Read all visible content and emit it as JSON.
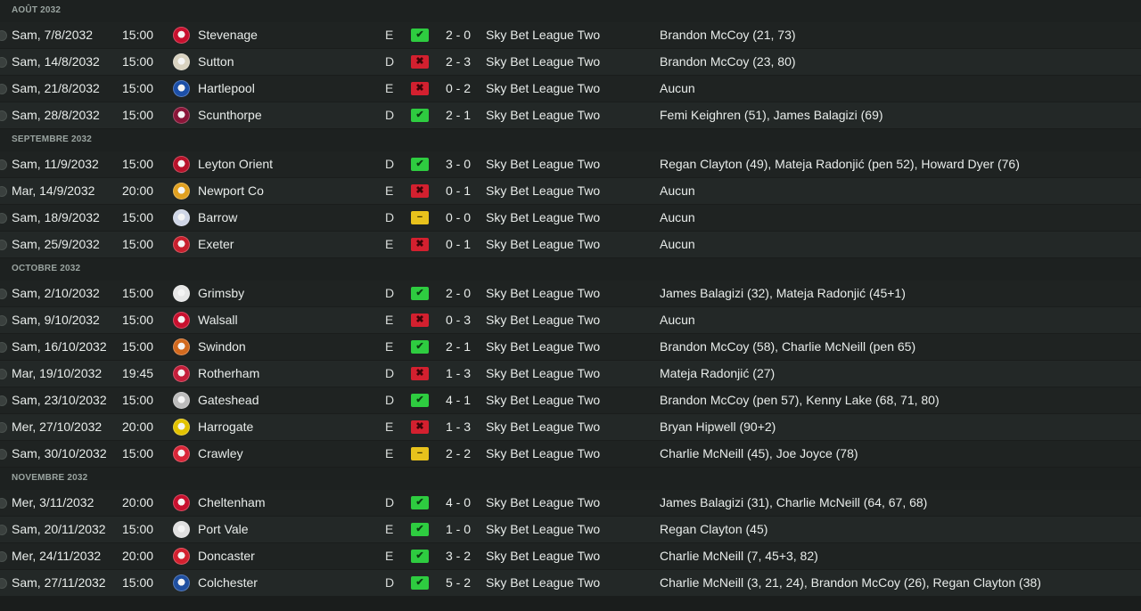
{
  "icons": {
    "win": "check-icon",
    "loss": "cross-icon",
    "draw": "minus-icon"
  },
  "colors": {
    "win": "#2ecc40",
    "loss": "#d3202f",
    "draw": "#e8c21c"
  },
  "months": [
    {
      "label": "AOÛT 2032",
      "matches": [
        {
          "date": "Sam, 7/8/2032",
          "time": "15:00",
          "team": "Stevenage",
          "venue": "E",
          "result": "win",
          "result_glyph": "✔",
          "score": "2 - 0",
          "competition": "Sky Bet League Two",
          "scorers": "Brandon McCoy (21, 73)",
          "crest_color": "#c8102e"
        },
        {
          "date": "Sam, 14/8/2032",
          "time": "15:00",
          "team": "Sutton",
          "venue": "D",
          "result": "loss",
          "result_glyph": "✖",
          "score": "2 - 3",
          "competition": "Sky Bet League Two",
          "scorers": "Brandon McCoy (23, 80)",
          "crest_color": "#d8d2c0"
        },
        {
          "date": "Sam, 21/8/2032",
          "time": "15:00",
          "team": "Hartlepool",
          "venue": "E",
          "result": "loss",
          "result_glyph": "✖",
          "score": "0 - 2",
          "competition": "Sky Bet League Two",
          "scorers": "Aucun",
          "crest_color": "#1c4fa8"
        },
        {
          "date": "Sam, 28/8/2032",
          "time": "15:00",
          "team": "Scunthorpe",
          "venue": "D",
          "result": "win",
          "result_glyph": "✔",
          "score": "2 - 1",
          "competition": "Sky Bet League Two",
          "scorers": "Femi Keighren (51), James Balagizi (69)",
          "crest_color": "#8a1538"
        }
      ]
    },
    {
      "label": "SEPTEMBRE 2032",
      "matches": [
        {
          "date": "Sam, 11/9/2032",
          "time": "15:00",
          "team": "Leyton Orient",
          "venue": "D",
          "result": "win",
          "result_glyph": "✔",
          "score": "3 - 0",
          "competition": "Sky Bet League Two",
          "scorers": "Regan Clayton (49), Mateja Radonjić (pen 52), Howard Dyer (76)",
          "crest_color": "#b8122a"
        },
        {
          "date": "Mar, 14/9/2032",
          "time": "20:00",
          "team": "Newport Co",
          "venue": "E",
          "result": "loss",
          "result_glyph": "✖",
          "score": "0 - 1",
          "competition": "Sky Bet League Two",
          "scorers": "Aucun",
          "crest_color": "#e0a020"
        },
        {
          "date": "Sam, 18/9/2032",
          "time": "15:00",
          "team": "Barrow",
          "venue": "D",
          "result": "draw",
          "result_glyph": "−",
          "score": "0 - 0",
          "competition": "Sky Bet League Two",
          "scorers": "Aucun",
          "crest_color": "#cfd6e6"
        },
        {
          "date": "Sam, 25/9/2032",
          "time": "15:00",
          "team": "Exeter",
          "venue": "E",
          "result": "loss",
          "result_glyph": "✖",
          "score": "0 - 1",
          "competition": "Sky Bet League Two",
          "scorers": "Aucun",
          "crest_color": "#c81f2d"
        }
      ]
    },
    {
      "label": "OCTOBRE 2032",
      "matches": [
        {
          "date": "Sam, 2/10/2032",
          "time": "15:00",
          "team": "Grimsby",
          "venue": "D",
          "result": "win",
          "result_glyph": "✔",
          "score": "2 - 0",
          "competition": "Sky Bet League Two",
          "scorers": "James Balagizi (32), Mateja Radonjić (45+1)",
          "crest_color": "#e6e6e6"
        },
        {
          "date": "Sam, 9/10/2032",
          "time": "15:00",
          "team": "Walsall",
          "venue": "E",
          "result": "loss",
          "result_glyph": "✖",
          "score": "0 - 3",
          "competition": "Sky Bet League Two",
          "scorers": "Aucun",
          "crest_color": "#c8102e"
        },
        {
          "date": "Sam, 16/10/2032",
          "time": "15:00",
          "team": "Swindon",
          "venue": "E",
          "result": "win",
          "result_glyph": "✔",
          "score": "2 - 1",
          "competition": "Sky Bet League Two",
          "scorers": "Brandon McCoy (58), Charlie McNeill (pen 65)",
          "crest_color": "#d2691e"
        },
        {
          "date": "Mar, 19/10/2032",
          "time": "19:45",
          "team": "Rotherham",
          "venue": "D",
          "result": "loss",
          "result_glyph": "✖",
          "score": "1 - 3",
          "competition": "Sky Bet League Two",
          "scorers": "Mateja Radonjić (27)",
          "crest_color": "#c41e3a"
        },
        {
          "date": "Sam, 23/10/2032",
          "time": "15:00",
          "team": "Gateshead",
          "venue": "D",
          "result": "win",
          "result_glyph": "✔",
          "score": "4 - 1",
          "competition": "Sky Bet League Two",
          "scorers": "Brandon McCoy (pen 57), Kenny Lake (68, 71, 80)",
          "crest_color": "#bcbcbc"
        },
        {
          "date": "Mer, 27/10/2032",
          "time": "20:00",
          "team": "Harrogate",
          "venue": "E",
          "result": "loss",
          "result_glyph": "✖",
          "score": "1 - 3",
          "competition": "Sky Bet League Two",
          "scorers": "Bryan Hipwell (90+2)",
          "crest_color": "#e2c200"
        },
        {
          "date": "Sam, 30/10/2032",
          "time": "15:00",
          "team": "Crawley",
          "venue": "E",
          "result": "draw",
          "result_glyph": "−",
          "score": "2 - 2",
          "competition": "Sky Bet League Two",
          "scorers": "Charlie McNeill (45), Joe Joyce (78)",
          "crest_color": "#d92638"
        }
      ]
    },
    {
      "label": "NOVEMBRE 2032",
      "matches": [
        {
          "date": "Mer, 3/11/2032",
          "time": "20:00",
          "team": "Cheltenham",
          "venue": "D",
          "result": "win",
          "result_glyph": "✔",
          "score": "4 - 0",
          "competition": "Sky Bet League Two",
          "scorers": "James Balagizi (31), Charlie McNeill (64, 67, 68)",
          "crest_color": "#c8102e"
        },
        {
          "date": "Sam, 20/11/2032",
          "time": "15:00",
          "team": "Port Vale",
          "venue": "E",
          "result": "win",
          "result_glyph": "✔",
          "score": "1 - 0",
          "competition": "Sky Bet League Two",
          "scorers": "Regan Clayton (45)",
          "crest_color": "#e0e0e0"
        },
        {
          "date": "Mer, 24/11/2032",
          "time": "20:00",
          "team": "Doncaster",
          "venue": "E",
          "result": "win",
          "result_glyph": "✔",
          "score": "3 - 2",
          "competition": "Sky Bet League Two",
          "scorers": "Charlie McNeill (7, 45+3, 82)",
          "crest_color": "#d3202f"
        },
        {
          "date": "Sam, 27/11/2032",
          "time": "15:00",
          "team": "Colchester",
          "venue": "D",
          "result": "win",
          "result_glyph": "✔",
          "score": "5 - 2",
          "competition": "Sky Bet League Two",
          "scorers": "Charlie McNeill (3, 21, 24), Brandon McCoy (26), Regan Clayton (38)",
          "crest_color": "#1f4fa0"
        }
      ]
    }
  ]
}
